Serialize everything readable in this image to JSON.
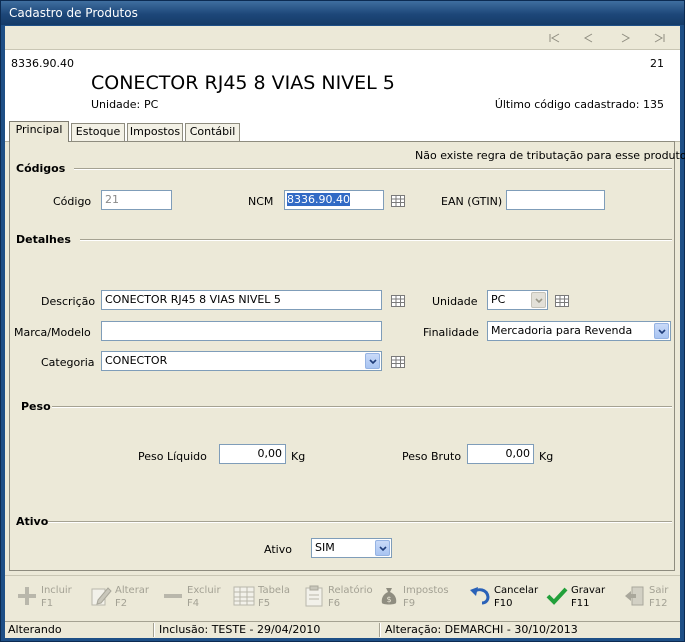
{
  "window": {
    "title": "Cadastro de Produtos"
  },
  "header": {
    "ncm_code": "8336.90.40",
    "product_id": "21",
    "product_name": "CONECTOR RJ45 8 VIAS NIVEL 5",
    "unit_label": "Unidade:",
    "unit_value": "PC",
    "last_code_text": "Último código cadastrado: 135"
  },
  "tabs": [
    {
      "label": "Principal",
      "active": true
    },
    {
      "label": "Estoque",
      "active": false
    },
    {
      "label": "Impostos",
      "active": false
    },
    {
      "label": "Contábil",
      "active": false
    }
  ],
  "form": {
    "tax_notice": "Não existe regra de tributação para esse produto",
    "sections": {
      "codigos": "Códigos",
      "detalhes": "Detalhes",
      "peso": "Peso",
      "ativo": "Ativo"
    },
    "codigo": {
      "label": "Código",
      "value": "21"
    },
    "ncm": {
      "label": "NCM",
      "value": "8336.90.40"
    },
    "ean": {
      "label": "EAN (GTIN)",
      "value": ""
    },
    "descricao": {
      "label": "Descrição",
      "value": "CONECTOR RJ45 8 VIAS NIVEL 5"
    },
    "unidade": {
      "label": "Unidade",
      "value": "PC"
    },
    "marca": {
      "label": "Marca/Modelo",
      "value": ""
    },
    "finalidade": {
      "label": "Finalidade",
      "value": "Mercadoria para Revenda"
    },
    "categoria": {
      "label": "Categoria",
      "value": "CONECTOR"
    },
    "peso_liquido": {
      "label": "Peso Líquido",
      "value": "0,00",
      "unit": "Kg"
    },
    "peso_bruto": {
      "label": "Peso Bruto",
      "value": "0,00",
      "unit": "Kg"
    },
    "ativo": {
      "label": "Ativo",
      "value": "SIM"
    }
  },
  "toolbar": {
    "incluir": {
      "label": "Incluir",
      "key": "F1",
      "enabled": false
    },
    "alterar": {
      "label": "Alterar",
      "key": "F2",
      "enabled": false
    },
    "excluir": {
      "label": "Excluir",
      "key": "F4",
      "enabled": false
    },
    "tabela": {
      "label": "Tabela",
      "key": "F5",
      "enabled": false
    },
    "relatorio": {
      "label": "Relatório",
      "key": "F6",
      "enabled": false
    },
    "impostos": {
      "label": "Impostos",
      "key": "F9",
      "enabled": false
    },
    "cancelar": {
      "label": "Cancelar",
      "key": "F10",
      "enabled": true
    },
    "gravar": {
      "label": "Gravar",
      "key": "F11",
      "enabled": true
    },
    "sair": {
      "label": "Sair",
      "key": "F12",
      "enabled": false
    }
  },
  "status": {
    "mode": "Alterando",
    "inclusao": "Inclusão: TESTE - 29/04/2010",
    "alteracao": "Alteração: DEMARCHI - 30/10/2013"
  },
  "colors": {
    "title_bar": "#1d4779",
    "accent_blue": "#316ac5",
    "disabled_text": "#a3a194",
    "panel_bg": "#ece9d8"
  }
}
